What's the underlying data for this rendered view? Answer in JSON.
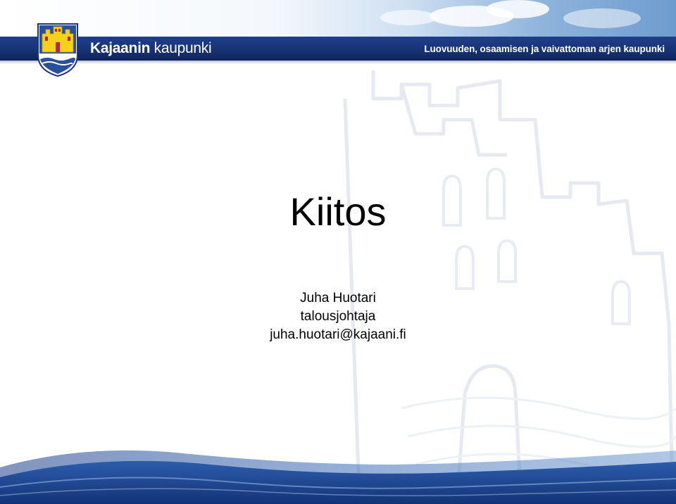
{
  "header": {
    "brand_bold": "Kajaanin",
    "brand_regular": " kaupunki",
    "slogan": "Luovuuden, osaamisen ja vaivattoman arjen kaupunki"
  },
  "crest_icon": "castle-crest-icon",
  "colors": {
    "header_blue": "#1a3677",
    "crest_yellow": "#f4d21b",
    "crest_red": "#c8232c",
    "wave_blue": "#2a5aa8"
  },
  "content": {
    "title": "Kiitos",
    "name": "Juha Huotari",
    "role": "talousjohtaja",
    "email": "juha.huotari@kajaani.fi"
  }
}
